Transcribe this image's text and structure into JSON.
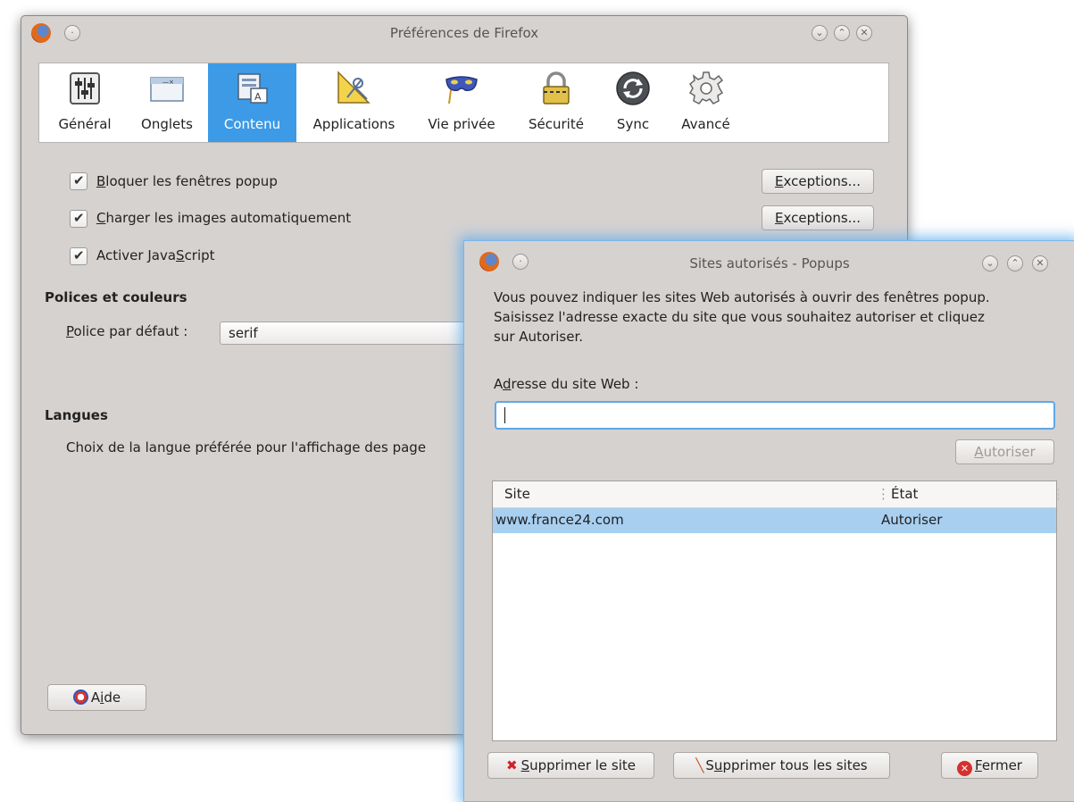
{
  "main": {
    "title": "Préférences de Firefox",
    "tabs": [
      {
        "label": "Général"
      },
      {
        "label": "Onglets"
      },
      {
        "label": "Contenu"
      },
      {
        "label": "Applications"
      },
      {
        "label": "Vie privée"
      },
      {
        "label": "Sécurité"
      },
      {
        "label": "Sync"
      },
      {
        "label": "Avancé"
      }
    ],
    "selected_tab": "Contenu",
    "options": [
      {
        "pre": "",
        "u": "B",
        "post": "loquer les fenêtres popup",
        "checked": true
      },
      {
        "pre": "",
        "u": "C",
        "post": "harger les images automatiquement",
        "checked": true
      },
      {
        "pre": "Activer Java",
        "u": "S",
        "post": "cript",
        "checked": true
      }
    ],
    "exceptions": {
      "u": "E",
      "post": "xceptions..."
    },
    "fonts_heading": "Polices et couleurs",
    "font_label": {
      "u": "P",
      "post": "olice par défaut :"
    },
    "font_value": "serif",
    "lang_heading": "Langues",
    "lang_text": "Choix de la langue préférée pour l'affichage des page",
    "help": {
      "pre": "A",
      "u": "i",
      "post": "de"
    }
  },
  "dialog": {
    "title": "Sites autorisés - Popups",
    "description": [
      "Vous pouvez indiquer les sites Web autorisés à ouvrir des fenêtres popup.",
      "Saisissez l'adresse exacte du site que vous souhaitez autoriser et cliquez",
      "sur Autoriser."
    ],
    "address_label": {
      "pre": "A",
      "u": "d",
      "post": "resse du site Web :"
    },
    "address_value": "",
    "allow": {
      "u": "A",
      "post": "utoriser"
    },
    "columns": {
      "site": "Site",
      "state": "État"
    },
    "rows": [
      {
        "site": "www.france24.com",
        "state": "Autoriser"
      }
    ],
    "remove": {
      "u": "S",
      "post": "upprimer le site"
    },
    "remove_all": {
      "pre": "S",
      "u": "u",
      "post": "pprimer tous les sites"
    },
    "close": {
      "u": "F",
      "post": "ermer"
    }
  },
  "colors": {
    "selection": "#3d9ae6",
    "row_selection": "#a8cff0",
    "focus": "#5da8e6"
  }
}
